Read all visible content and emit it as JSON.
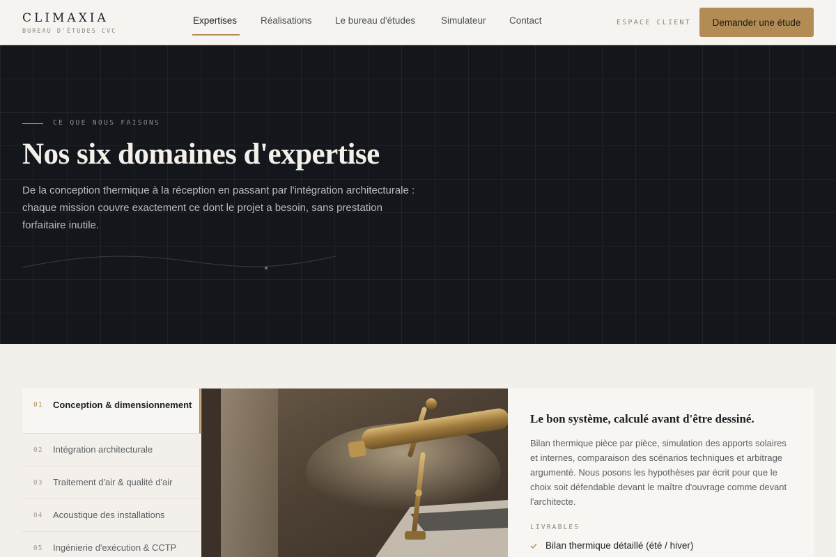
{
  "brand": {
    "name": "CLIMAXIA",
    "tagline": "BUREAU D'ÉTUDES CVC"
  },
  "nav": {
    "items": [
      {
        "label": "Expertises",
        "active": true
      },
      {
        "label": "Réalisations"
      },
      {
        "label": "Le bureau d'études"
      },
      {
        "label": "Simulateur"
      },
      {
        "label": "Contact"
      }
    ],
    "client_link": "ESPACE CLIENT",
    "cta_label": "Demander une étude"
  },
  "hero": {
    "eyebrow": "CE QUE NOUS FAISONS",
    "title": "Nos six domaines d'expertise",
    "description": "De la conception thermique à la réception en passant par l'intégration architecturale : chaque mission couvre exactement ce dont le projet a besoin, sans prestation forfaitaire inutile."
  },
  "expertises": {
    "items": [
      {
        "num": "01",
        "label": "Conception & dimensionnement",
        "active": true
      },
      {
        "num": "02",
        "label": "Intégration architecturale"
      },
      {
        "num": "03",
        "label": "Traitement d'air & qualité d'air"
      },
      {
        "num": "04",
        "label": "Acoustique des installations"
      },
      {
        "num": "05",
        "label": "Ingénierie d'exécution & CCTP"
      }
    ]
  },
  "detail": {
    "title": "Le bon système, calculé avant d'être dessiné.",
    "description": "Bilan thermique pièce par pièce, simulation des apports solaires et internes, comparaison des scénarios techniques et arbitrage argumenté. Nous posons les hypothèses par écrit pour que le choix soit défendable devant le maître d'ouvrage comme devant l'architecte.",
    "deliverables_label": "LIVRABLES",
    "deliverables": [
      "Bilan thermique détaillé (été / hiver)"
    ]
  },
  "colors": {
    "accent": "#b38b54",
    "hero_bg": "#13171c",
    "page_bg": "#f3f0eb",
    "panel_bg": "#f8f6f2"
  },
  "icons": {
    "deliverable_check": "check-icon",
    "photo": "desk-lamp-photo"
  }
}
